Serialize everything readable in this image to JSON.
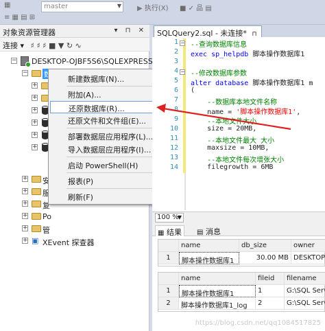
{
  "toolbar": {
    "db_combo": "master",
    "execute_label": "执行(X)"
  },
  "object_explorer": {
    "title": "对象资源管理器",
    "connect_label": "连接",
    "server_node": "DESKTOP-OJBF5S6\\SQLEXPRESS (S",
    "selected_db_label": "数据库",
    "partial_nodes": [
      "安",
      "服",
      "复",
      "Po",
      "管"
    ],
    "xevent_label": "XEvent 探查器"
  },
  "context_menu": {
    "items": [
      {
        "label": "新建数据库(N)..."
      },
      {
        "label": "附加(A)..."
      },
      {
        "label": "还原数据库(R)..."
      },
      {
        "label": "还原文件和文件组(E)..."
      },
      {
        "label": "部署数据层应用程序(L)..."
      },
      {
        "label": "导入数据层应用程序(I)..."
      },
      {
        "label": "启动 PowerShell(H)"
      },
      {
        "label": "报表(P)"
      },
      {
        "label": "刷新(F)"
      }
    ]
  },
  "editor": {
    "tab_label": "SQLQuery2.sql - 未连接*",
    "lines": [
      {
        "n": "1",
        "text": "--查询数据库信息",
        "cls": "cm"
      },
      {
        "n": "2",
        "text": "exec sp_helpdb 脚本操作数据库1",
        "cls": "kwmix1"
      },
      {
        "n": "3",
        "text": "",
        "cls": "tx"
      },
      {
        "n": "4",
        "text": "--修改数据库参数",
        "cls": "cm"
      },
      {
        "n": "5",
        "text": "alter database 脚本操作数据库1 m",
        "cls": "kwmix2"
      },
      {
        "n": "6",
        "text": "(",
        "cls": "tx"
      },
      {
        "n": "7",
        "text": "    --数据库本地文件名称",
        "cls": "cm"
      },
      {
        "n": "8",
        "text": "    name = '脚本操作数据库1',",
        "cls": "strmix"
      },
      {
        "n": "9",
        "text": "    --本地文件大小",
        "cls": "cm"
      },
      {
        "n": "10",
        "text": "    size = 20MB,",
        "cls": "tx"
      },
      {
        "n": "11",
        "text": "    --本地文件最大 大小",
        "cls": "cm"
      },
      {
        "n": "12",
        "text": "    maxsize = 10MB,",
        "cls": "tx"
      },
      {
        "n": "13",
        "text": "    --本地文件每次增张大小",
        "cls": "cm"
      },
      {
        "n": "14",
        "text": "    filegrowth = 6MB",
        "cls": "tx"
      }
    ],
    "zoom": "100 %"
  },
  "results": {
    "tabs": [
      "结果",
      "消息"
    ],
    "grid1": {
      "headers": [
        "name",
        "db_size",
        "owner"
      ],
      "rows": [
        [
          "1",
          "脚本操作数据库1",
          "30.00 MB",
          "DESKTOP-"
        ]
      ]
    },
    "grid2": {
      "headers": [
        "name",
        "fileid",
        "filename"
      ],
      "rows": [
        [
          "1",
          "脚本操作数据库1",
          "1",
          "G:\\SQL Serv"
        ],
        [
          "2",
          "脚本操作数据库1_log",
          "2",
          "G:\\SQL Serv"
        ]
      ]
    }
  },
  "watermark": "https://blog.csdn.net/qq1084517825",
  "colors": {
    "arrow": "#e02020",
    "selection": "#3399ff",
    "comment": "#008000",
    "keyword": "#0000ff"
  }
}
